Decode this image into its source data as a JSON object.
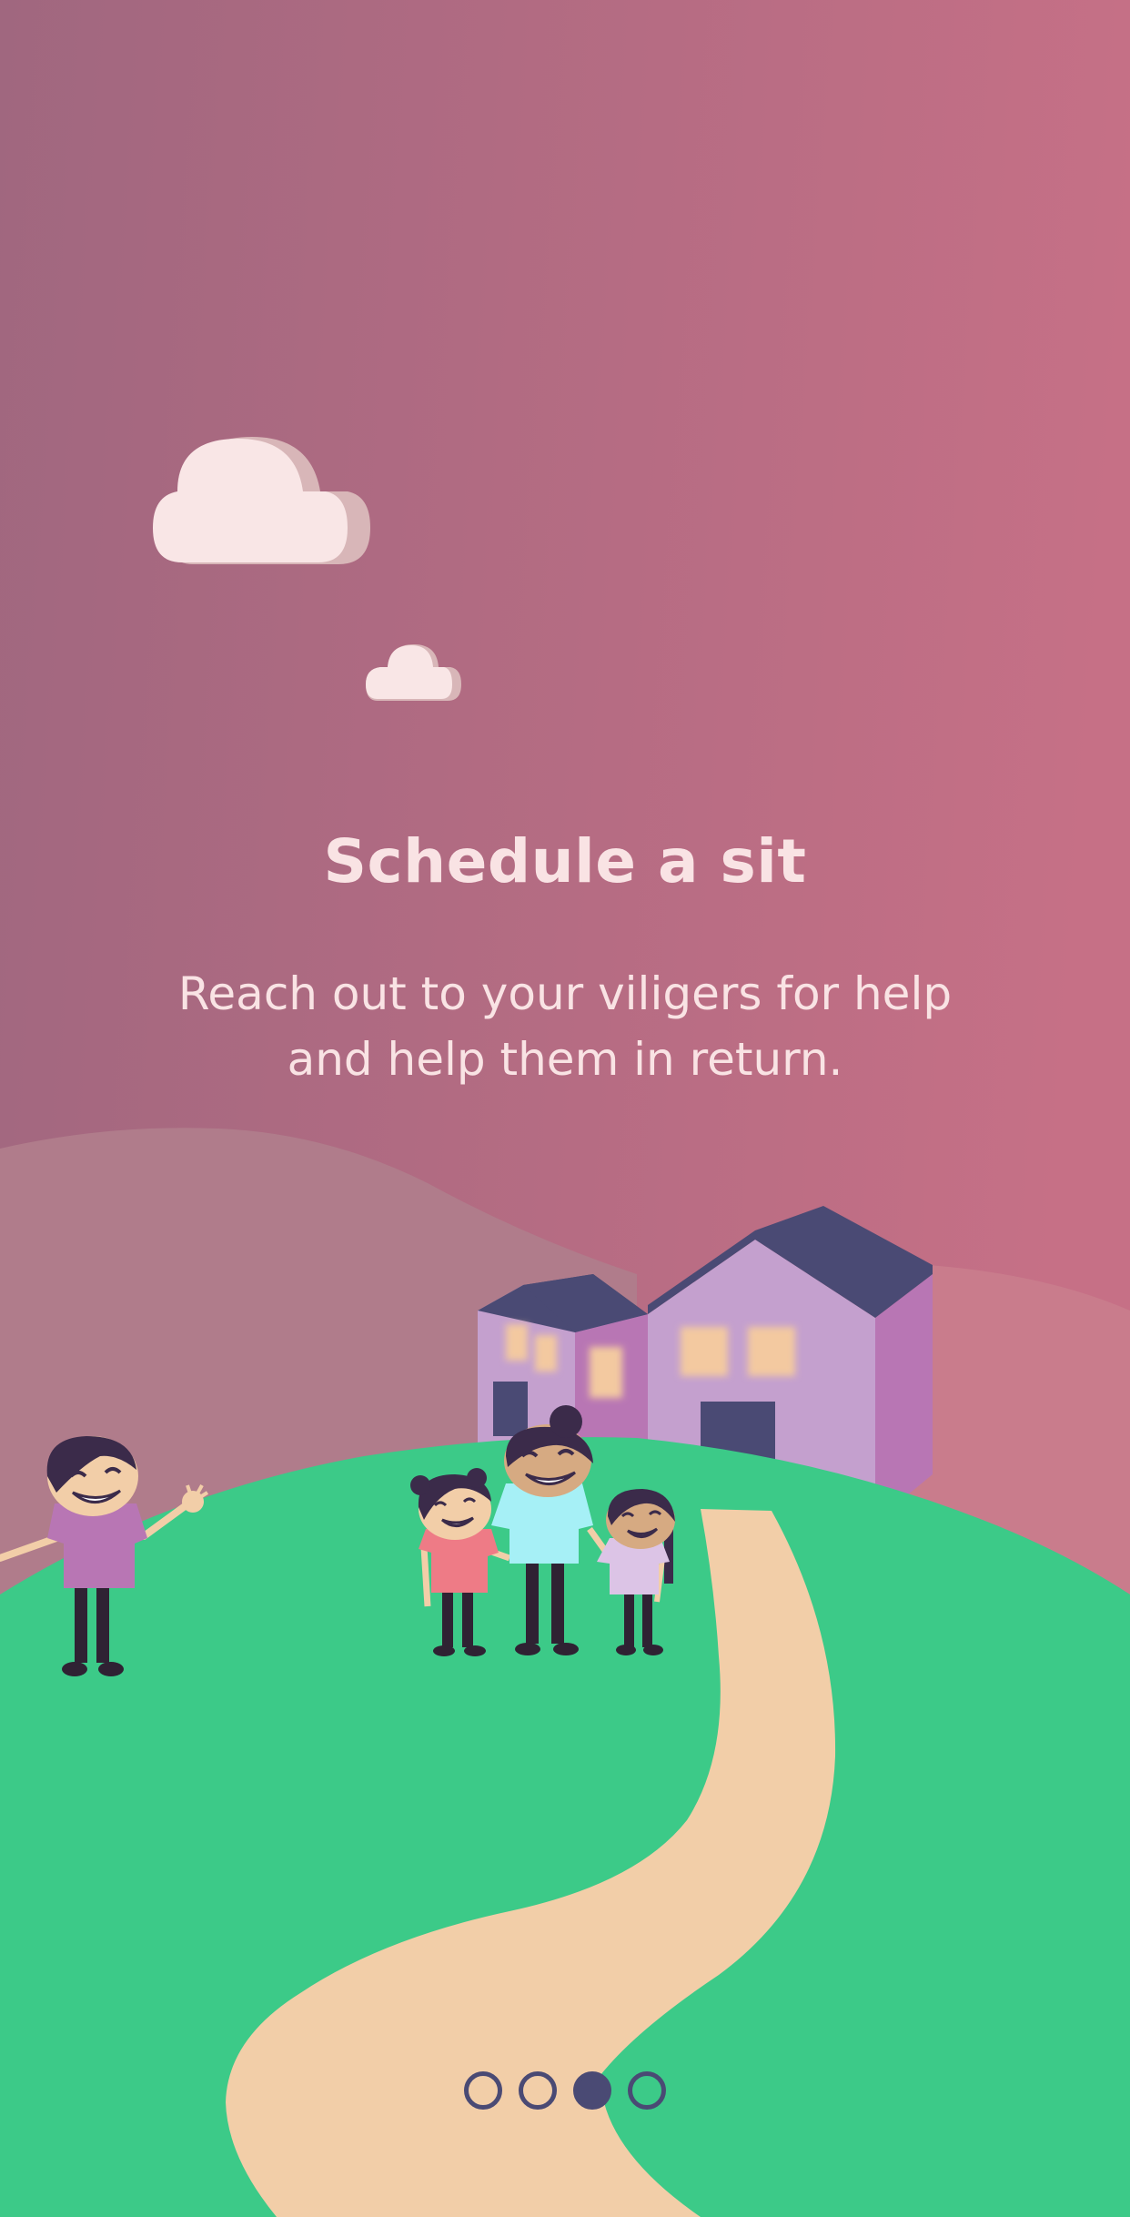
{
  "onboarding": {
    "title": "Schedule a sit",
    "subtitle": "Reach out to your viligers for help and help them in return.",
    "pagination": {
      "total": 4,
      "active_index": 2
    }
  },
  "colors": {
    "sky_left": "#a0677f",
    "sky_right": "#c67086",
    "text": "#f9e3e4",
    "grass": "#3cca88",
    "path": "#f2cea8",
    "roof": "#4a4a74",
    "house": "#c4a0ce",
    "dot": "#4a4a74"
  }
}
